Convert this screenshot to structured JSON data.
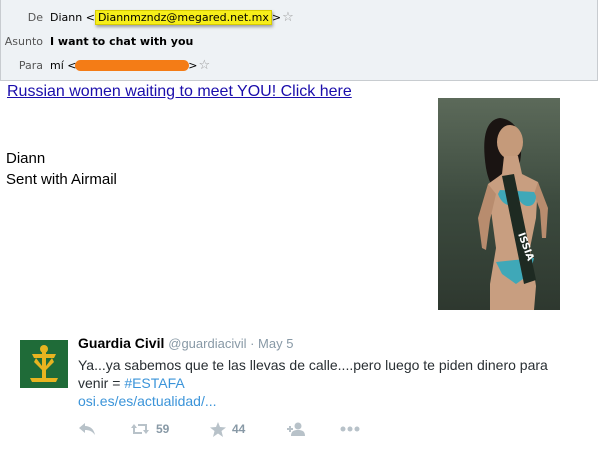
{
  "email": {
    "from": {
      "label": "De",
      "name": "Diann",
      "address": "Diannmzndz@megared.net.mx"
    },
    "subject": {
      "label": "Asunto",
      "value": "I want to chat with you"
    },
    "to": {
      "label": "Para",
      "name": "mí"
    },
    "promo_link": "Russian women waiting to meet YOU! Click here",
    "signature_name": "Diann",
    "signature_line": "Sent with Airmail"
  },
  "tweet": {
    "author": "Guardia Civil",
    "handle": "@guardiacivil",
    "date": "May 5",
    "text_1": "Ya...ya sabemos que te las llevas de calle....pero luego te piden dinero para venir = ",
    "hashtag": "#ESTAFA",
    "link": "osi.es/es/actualidad/...",
    "retweets": "59",
    "favorites": "44"
  },
  "colors": {
    "highlight": "#f6ee1a",
    "redaction": "#f47c16",
    "link": "#1a0dab",
    "twitter_link": "#3b94d9"
  }
}
